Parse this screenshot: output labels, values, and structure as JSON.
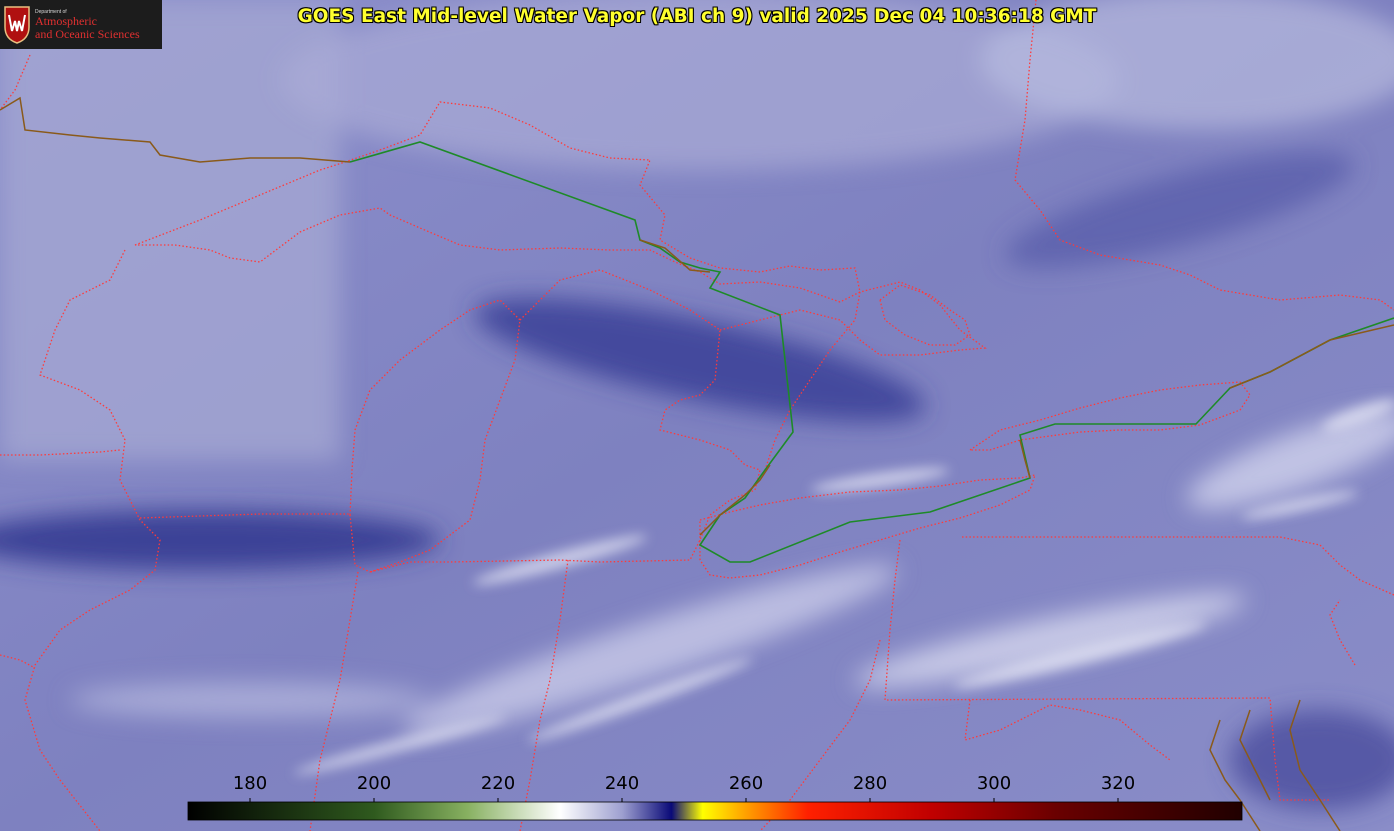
{
  "title": "GOES East Mid-level Water Vapor (ABI ch 9)  valid 2025 Dec 04 10:36:18 GMT",
  "logo": {
    "icon": "uw-crest-icon",
    "dept_text": "Department of",
    "line1": "Atmospheric",
    "line2": "and Oceanic Sciences"
  },
  "colorbar": {
    "min": 170,
    "max": 340,
    "ticks": [
      180,
      200,
      220,
      240,
      260,
      280,
      300,
      320
    ],
    "stops": [
      {
        "v": 170,
        "color": "#000000"
      },
      {
        "v": 200,
        "color": "#2f5a1e"
      },
      {
        "v": 215,
        "color": "#87b060"
      },
      {
        "v": 230,
        "color": "#ffffff"
      },
      {
        "v": 240,
        "color": "#9ea0d0"
      },
      {
        "v": 248,
        "color": "#0a0a78"
      },
      {
        "v": 253,
        "color": "#ffff00"
      },
      {
        "v": 260,
        "color": "#ffa000"
      },
      {
        "v": 270,
        "color": "#ff2000"
      },
      {
        "v": 290,
        "color": "#c00000"
      },
      {
        "v": 310,
        "color": "#6a0000"
      },
      {
        "v": 340,
        "color": "#200000"
      }
    ]
  },
  "colors": {
    "state_borders": "#ff3a3a",
    "international_border": "#1e8a28",
    "coastline": "#8a5a1a",
    "title_text": "#ffff2e"
  }
}
